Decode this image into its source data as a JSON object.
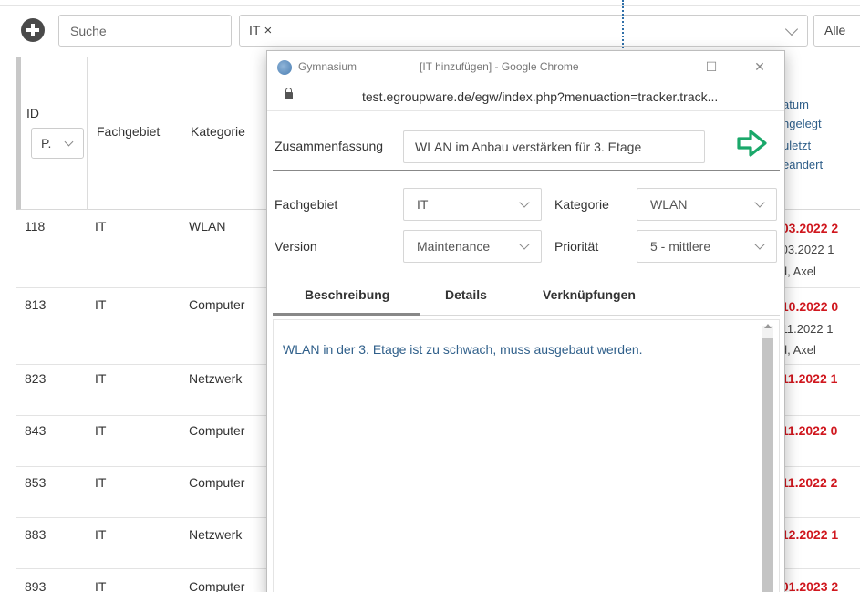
{
  "toolbar": {
    "search_placeholder": "Suche",
    "filter_tag": "IT",
    "filter_remove": "×",
    "alle": "Alle"
  },
  "grid": {
    "headers": {
      "id": "ID",
      "id_select": "P.",
      "fachgebiet": "Fachgebiet",
      "kategorie": "Kategorie",
      "datum_lines": [
        "atum",
        "ngelegt",
        "uletzt",
        "eändert"
      ]
    },
    "rows": [
      {
        "id": "118",
        "fachgebiet": "IT",
        "kategorie": "WLAN",
        "date_red": ".03.2022 2",
        "date_gray": ".03.2022 1",
        "user": "ld, Axel"
      },
      {
        "id": "813",
        "fachgebiet": "IT",
        "kategorie": "Computer",
        "date_red": ".10.2022 0",
        "date_gray": ".11.2022 1",
        "user": "ld, Axel"
      },
      {
        "id": "823",
        "fachgebiet": "IT",
        "kategorie": "Netzwerk",
        "date_red": ".11.2022 1",
        "date_gray": "",
        "user": ""
      },
      {
        "id": "843",
        "fachgebiet": "IT",
        "kategorie": "Computer",
        "date_red": ".11.2022 0",
        "date_gray": "",
        "user": ""
      },
      {
        "id": "853",
        "fachgebiet": "IT",
        "kategorie": "Computer",
        "date_red": ".11.2022 2",
        "date_gray": "",
        "user": ""
      },
      {
        "id": "883",
        "fachgebiet": "IT",
        "kategorie": "Netzwerk",
        "date_red": ".12.2022 1",
        "date_gray": "",
        "user": ""
      },
      {
        "id": "893",
        "fachgebiet": "IT",
        "kategorie": "Computer",
        "date_red": ".01.2023 2",
        "date_gray": "",
        "user": ""
      }
    ]
  },
  "popup": {
    "app_name": "Gymnasium",
    "window_title": "[IT hinzufügen] - Google Chrome",
    "url": "test.egroupware.de/egw/index.php?menuaction=tracker.track...",
    "summary_label": "Zusammenfassung",
    "summary_value": "WLAN im Anbau verstärken für 3. Etage",
    "fields": {
      "fachgebiet_label": "Fachgebiet",
      "fachgebiet_value": "IT",
      "kategorie_label": "Kategorie",
      "kategorie_value": "WLAN",
      "version_label": "Version",
      "version_value": "Maintenance",
      "prioritaet_label": "Priorität",
      "prioritaet_value": "5 - mittlere"
    },
    "tabs": [
      "Beschreibung",
      "Details",
      "Verknüpfungen"
    ],
    "description": "WLAN in der 3. Etage ist zu schwach, muss ausgebaut werden.",
    "colors": {
      "apply_icon": "#1aa86a",
      "date_red": "#d0171e",
      "link_blue": "#2f5f8a"
    },
    "icons": {
      "add": "plus-circle-icon",
      "apply": "arrow-apply-icon",
      "lock": "lock-icon"
    }
  }
}
